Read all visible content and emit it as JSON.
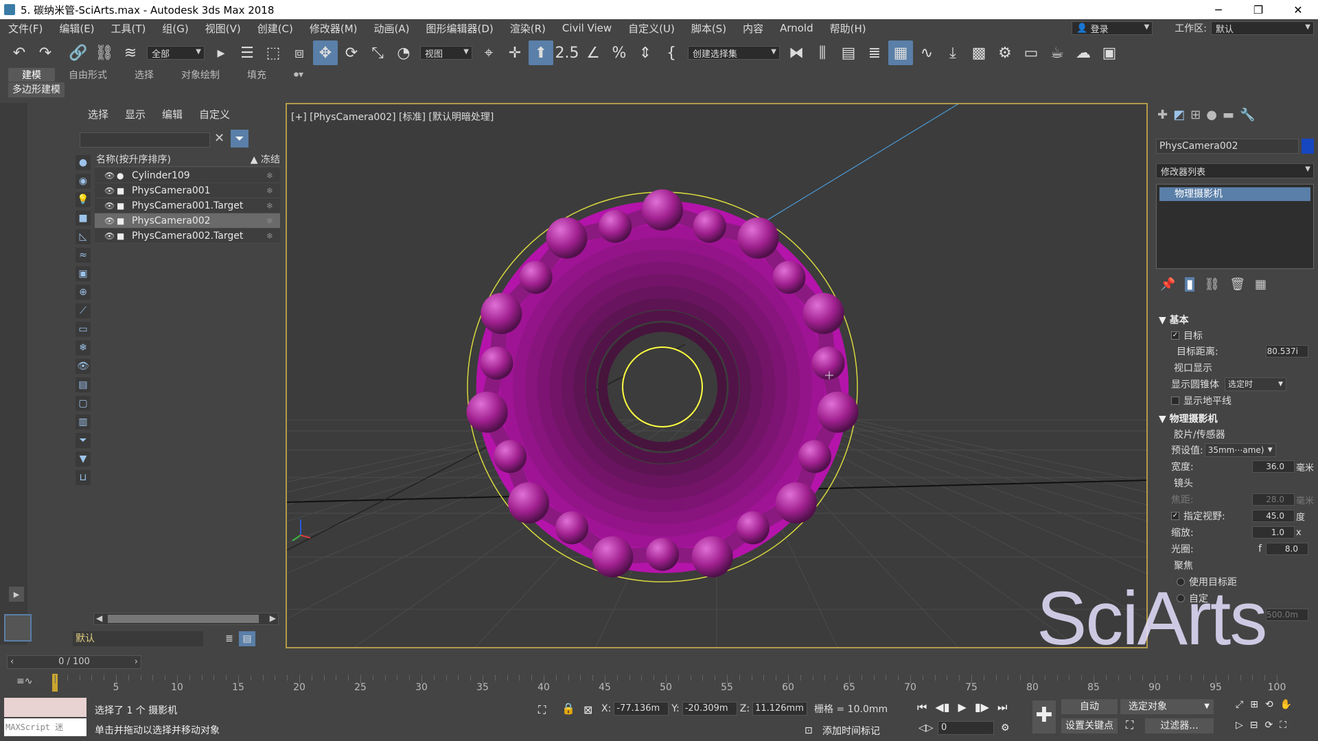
{
  "titlebar": {
    "title": "5. 碳纳米管-SciArts.max - Autodesk 3ds Max 2018",
    "minimize": "─",
    "restore": "❐",
    "close": "✕"
  },
  "menu": [
    "文件(F)",
    "编辑(E)",
    "工具(T)",
    "组(G)",
    "视图(V)",
    "创建(C)",
    "修改器(M)",
    "动画(A)",
    "图形编辑器(D)",
    "渲染(R)",
    "Civil View",
    "自定义(U)",
    "脚本(S)",
    "内容",
    "Arnold",
    "帮助(H)"
  ],
  "login": {
    "label": "登录",
    "workspace_label": "工作区:",
    "workspace_value": "默认"
  },
  "toolbar": {
    "selection_filter": "全部",
    "ref_coord": "视图",
    "named_selection": "创建选择集"
  },
  "ribbon": {
    "tabs": [
      "建模",
      "自由形式",
      "选择",
      "对象绘制",
      "填充"
    ],
    "sub": "多边形建模"
  },
  "explorer": {
    "tabs": [
      "选择",
      "显示",
      "编辑",
      "自定义"
    ],
    "col_name": "名称(按升序排序)",
    "col_freeze": "冻结",
    "rows": [
      {
        "name": "Cylinder109",
        "icon": "sphere-icon"
      },
      {
        "name": "PhysCamera001",
        "icon": "camera-icon"
      },
      {
        "name": "PhysCamera001.Target",
        "icon": "camera-icon"
      },
      {
        "name": "PhysCamera002",
        "icon": "camera-icon",
        "selected": true
      },
      {
        "name": "PhysCamera002.Target",
        "icon": "camera-icon"
      }
    ],
    "layer": "默认"
  },
  "viewport": {
    "label": "[+] [PhysCamera002] [标准] [默认明暗处理]",
    "tube_color": "#a0208f",
    "outline_color": "#ffff40"
  },
  "cmdpanel": {
    "object_name": "PhysCamera002",
    "object_color": "#1646c0",
    "modifier_list": "修改器列表",
    "stack_item": "物理摄影机",
    "basic": {
      "head": "基本",
      "target": "目标",
      "target_dist_label": "目标距离:",
      "target_dist_value": "80.537i",
      "viewport_display": "视口显示",
      "show_cone": "显示圆锥体",
      "show_cone_value": "选定时",
      "show_horizon": "显示地平线"
    },
    "physcam": {
      "head": "物理摄影机",
      "film": "胶片/传感器",
      "preset_label": "预设值:",
      "preset_value": "35mm⋯ame)",
      "width_label": "宽度:",
      "width_value": "36.0",
      "width_unit": "毫米",
      "lens": "镜头",
      "focal_label": "焦距:",
      "focal_value": "28.0",
      "focal_unit": "毫米",
      "fov_label": "指定视野:",
      "fov_value": "45.0",
      "fov_unit": "度",
      "zoom_label": "缩放:",
      "zoom_value": "1.0",
      "zoom_unit": "x",
      "aperture_label": "光圈:",
      "aperture_prefix": "f",
      "aperture_value": "8.0",
      "focus": "聚焦",
      "use_target": "使用目标距",
      "custom": "自定",
      "focus_dist_value": "500.0m"
    }
  },
  "watermark": "SciArts",
  "timeline": {
    "slider": "0 / 100",
    "ticks": [
      "5",
      "10",
      "15",
      "20",
      "25",
      "30",
      "35",
      "40",
      "45",
      "50",
      "55",
      "60",
      "65",
      "70",
      "75",
      "80",
      "85",
      "90",
      "95",
      "100"
    ]
  },
  "status": {
    "selected": "选择了 1 个 摄影机",
    "hint": "单击并拖动以选择并移动对象",
    "maxscript": "MAXScript 迷",
    "x_label": "X:",
    "x_value": "-77.136m",
    "y_label": "Y:",
    "y_value": "-20.309m",
    "z_label": "Z:",
    "z_value": "11.126mm",
    "grid": "栅格 = 10.0mm",
    "add_time_tag": "添加时间标记",
    "auto": "自动",
    "sel_obj": "选定对象",
    "set_key": "设置关键点",
    "filters": "过滤器...",
    "frame": "0"
  }
}
